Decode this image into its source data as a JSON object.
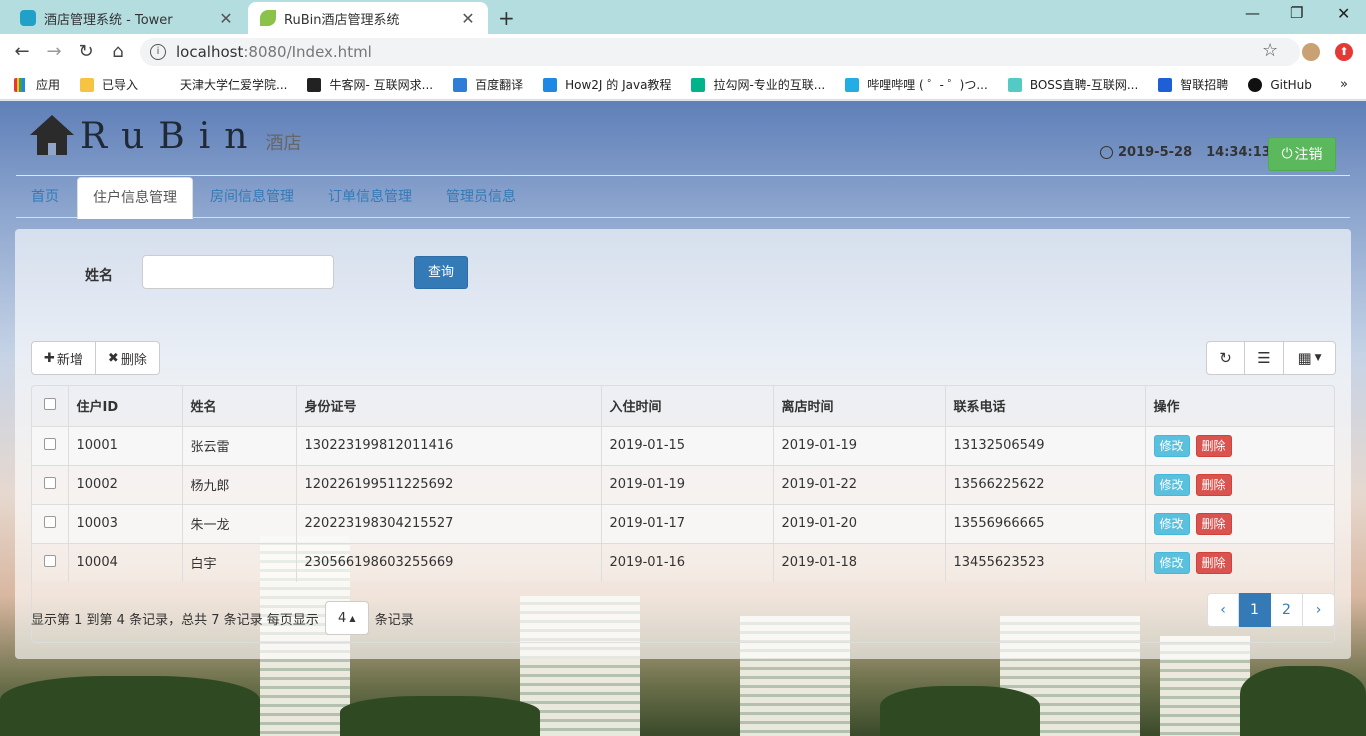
{
  "browser": {
    "tabs": [
      {
        "title": "酒店管理系统 - Tower",
        "active": false
      },
      {
        "title": "RuBin酒店管理系统",
        "active": true
      }
    ],
    "url_host": "localhost",
    "url_rest": ":8080/Index.html",
    "bookmarks": [
      {
        "label": "应用",
        "color": "#e57373"
      },
      {
        "label": "已导入",
        "color": "#f6c343"
      },
      {
        "label": "天津大学仁爱学院...",
        "color": "#ffffff"
      },
      {
        "label": "牛客网- 互联网求...",
        "color": "#222222"
      },
      {
        "label": "百度翻译",
        "color": "#2e7dd7"
      },
      {
        "label": "How2J 的 Java教程",
        "color": "#1e88e5"
      },
      {
        "label": "拉勾网-专业的互联...",
        "color": "#00b38a"
      },
      {
        "label": "哔哩哔哩 ( ゜- ゜)つ...",
        "color": "#23ade5"
      },
      {
        "label": "BOSS直聘-互联网...",
        "color": "#53cac3"
      },
      {
        "label": "智联招聘",
        "color": "#1e5fd6"
      },
      {
        "label": "GitHub",
        "color": "#111111"
      }
    ],
    "more": "»"
  },
  "header": {
    "brand": "RuBin",
    "brand_sub": "酒店",
    "date": "2019-5-28",
    "time": "14:34:13",
    "logout_label": "注销"
  },
  "nav": {
    "tabs": [
      {
        "label": "首页",
        "active": false
      },
      {
        "label": "住户信息管理",
        "active": true
      },
      {
        "label": "房间信息管理",
        "active": false
      },
      {
        "label": "订单信息管理",
        "active": false
      },
      {
        "label": "管理员信息",
        "active": false
      }
    ]
  },
  "search": {
    "name_label": "姓名",
    "name_value": "",
    "query_label": "查询"
  },
  "toolbar": {
    "add_label": "新增",
    "delete_label": "删除"
  },
  "table": {
    "columns": [
      "住户ID",
      "姓名",
      "身份证号",
      "入住时间",
      "离店时间",
      "联系电话",
      "操作"
    ],
    "rows": [
      {
        "id": "10001",
        "name": "张云雷",
        "idcard": "130223199812011416",
        "checkin": "2019-01-15",
        "checkout": "2019-01-19",
        "phone": "13132506549"
      },
      {
        "id": "10002",
        "name": "杨九郎",
        "idcard": "120226199511225692",
        "checkin": "2019-01-19",
        "checkout": "2019-01-22",
        "phone": "13566225622"
      },
      {
        "id": "10003",
        "name": "朱一龙",
        "idcard": "220223198304215527",
        "checkin": "2019-01-17",
        "checkout": "2019-01-20",
        "phone": "13556966665"
      },
      {
        "id": "10004",
        "name": "白宇",
        "idcard": "230566198603255669",
        "checkin": "2019-01-16",
        "checkout": "2019-01-18",
        "phone": "13455623523"
      }
    ],
    "edit_label": "修改",
    "del_label": "删除"
  },
  "pager": {
    "info_prefix": "显示第 1 到第 4 条记录，总共 7 条记录 每页显示",
    "page_size": "4",
    "info_suffix": "条记录",
    "prev": "‹",
    "pages": [
      "1",
      "2"
    ],
    "current": "1",
    "next": "›"
  },
  "colors": {
    "primary": "#337ab7",
    "success": "#5cb85c",
    "info": "#5bc0de",
    "danger": "#d9534f"
  }
}
